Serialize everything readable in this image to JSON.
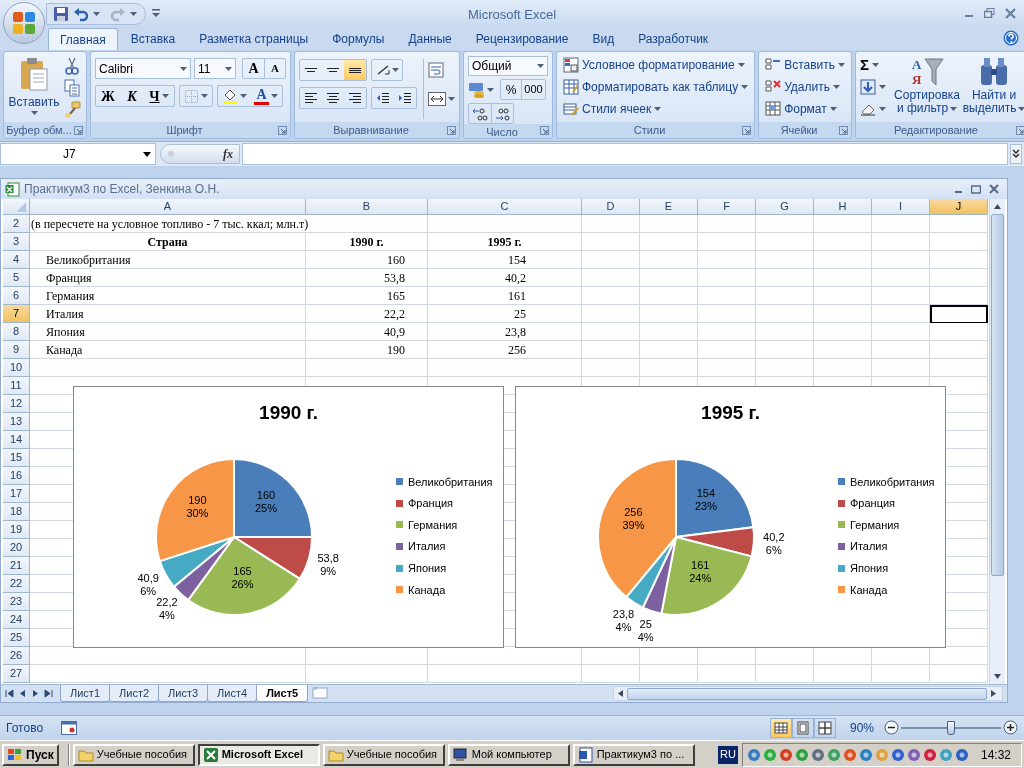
{
  "window": {
    "title": "Microsoft Excel"
  },
  "tabs": [
    {
      "label": "Главная",
      "selected": true
    },
    {
      "label": "Вставка",
      "selected": false
    },
    {
      "label": "Разметка страницы",
      "selected": false
    },
    {
      "label": "Формулы",
      "selected": false
    },
    {
      "label": "Данные",
      "selected": false
    },
    {
      "label": "Рецензирование",
      "selected": false
    },
    {
      "label": "Вид",
      "selected": false
    },
    {
      "label": "Разработчик",
      "selected": false
    }
  ],
  "ribbon": {
    "clipboard": {
      "label": "Буфер обм...",
      "paste": "Вставить"
    },
    "font": {
      "label": "Шрифт",
      "font_name": "Calibri",
      "font_size": "11",
      "grow_glyph": "A",
      "shrink_glyph": "A",
      "bold": "Ж",
      "italic": "К",
      "underline": "Ч",
      "font_color_glyph": "A"
    },
    "alignment": {
      "label": "Выравнивание",
      "vertical_align": [
        {
          "selected": false
        },
        {
          "selected": false
        },
        {
          "selected": true
        }
      ]
    },
    "number": {
      "label": "Число",
      "format": "Общий",
      "percent": "%",
      "thousands": "000"
    },
    "styles": {
      "label": "Стили",
      "items": [
        "Условное форматирование",
        "Форматировать как таблицу",
        "Стили ячеек"
      ]
    },
    "cells": {
      "label": "Ячейки",
      "items": [
        "Вставить",
        "Удалить",
        "Формат"
      ]
    },
    "editing": {
      "label": "Редактирование",
      "sum_glyph": "Σ",
      "sort_glyphs": [
        "А",
        "Я"
      ],
      "sort": [
        "Сортировка",
        "и фильтр"
      ],
      "find": [
        "Найти и",
        "выделить"
      ]
    }
  },
  "formula_bar": {
    "name_box": "J7",
    "function_glyph": "fx"
  },
  "workbook": {
    "title": "Практикум3 по Excel, Зенкина О.Н.",
    "columns": [
      {
        "label": "A",
        "selected": false
      },
      {
        "label": "B",
        "selected": false
      },
      {
        "label": "C",
        "selected": false
      },
      {
        "label": "D",
        "selected": false
      },
      {
        "label": "E",
        "selected": false
      },
      {
        "label": "F",
        "selected": false
      },
      {
        "label": "G",
        "selected": false
      },
      {
        "label": "H",
        "selected": false
      },
      {
        "label": "I",
        "selected": false
      },
      {
        "label": "J",
        "selected": true
      }
    ],
    "rows": [
      {
        "number": "2",
        "selected": false,
        "kind": "note",
        "cells": [
          "(в пересчете на условное топливо  - 7 тыс. ккал; млн.т)"
        ]
      },
      {
        "number": "3",
        "selected": false,
        "kind": "header",
        "cells": [
          "Страна",
          "1990 г.",
          "1995 г."
        ]
      },
      {
        "number": "4",
        "selected": false,
        "kind": "data",
        "cells": [
          "Великобритания",
          "160",
          "154"
        ]
      },
      {
        "number": "5",
        "selected": false,
        "kind": "data",
        "cells": [
          "Франция",
          "53,8",
          "40,2"
        ]
      },
      {
        "number": "6",
        "selected": false,
        "kind": "data",
        "cells": [
          "Германия",
          "165",
          "161"
        ]
      },
      {
        "number": "7",
        "selected": true,
        "kind": "data",
        "cells": [
          "Италия",
          "22,2",
          "25"
        ]
      },
      {
        "number": "8",
        "selected": false,
        "kind": "data",
        "cells": [
          "Япония",
          "40,9",
          "23,8"
        ]
      },
      {
        "number": "9",
        "selected": false,
        "kind": "data",
        "cells": [
          "Канада",
          "190",
          "256"
        ]
      },
      {
        "number": "10",
        "selected": false
      },
      {
        "number": "11",
        "selected": false
      },
      {
        "number": "12",
        "selected": false
      },
      {
        "number": "13",
        "selected": false
      },
      {
        "number": "14",
        "selected": false
      },
      {
        "number": "15",
        "selected": false
      },
      {
        "number": "16",
        "selected": false
      },
      {
        "number": "17",
        "selected": false
      },
      {
        "number": "18",
        "selected": false
      },
      {
        "number": "19",
        "selected": false
      },
      {
        "number": "20",
        "selected": false
      },
      {
        "number": "21",
        "selected": false
      },
      {
        "number": "22",
        "selected": false
      },
      {
        "number": "23",
        "selected": false
      },
      {
        "number": "24",
        "selected": false
      },
      {
        "number": "25",
        "selected": false
      },
      {
        "number": "26",
        "selected": false
      },
      {
        "number": "27",
        "selected": false
      }
    ],
    "charts": [
      {
        "chart_data": {
          "type": "pie",
          "title": "1990 г.",
          "categories": [
            "Великобритания",
            "Франция",
            "Германия",
            "Италия",
            "Япония",
            "Канада"
          ],
          "series": [
            {
              "values": [
                25,
                9,
                26,
                4,
                6,
                30
              ]
            }
          ],
          "legend": true,
          "colors": [
            "#4a7ebb",
            "#be4b48",
            "#98b954",
            "#7d60a0",
            "#46aac5",
            "#f79646"
          ],
          "value_labels": [
            "160\n25%",
            "53,8\n9%",
            "165\n26%",
            "22,2\n4%",
            "40,9\n6%",
            "190\n30%"
          ]
        }
      },
      {
        "chart_data": {
          "type": "pie",
          "title": "1995 г.",
          "categories": [
            "Великобритания",
            "Франция",
            "Германия",
            "Италия",
            "Япония",
            "Канада"
          ],
          "series": [
            {
              "values": [
                23,
                6,
                24,
                4,
                4,
                39
              ]
            }
          ],
          "legend": true,
          "colors": [
            "#4a7ebb",
            "#be4b48",
            "#98b954",
            "#7d60a0",
            "#46aac5",
            "#f79646"
          ],
          "value_labels": [
            "154\n23%",
            "40,2\n6%",
            "161\n24%",
            "25\n4%",
            "23,8\n4%",
            "256\n39%"
          ]
        }
      }
    ],
    "sheet_tabs": [
      {
        "label": "Лист1",
        "selected": false
      },
      {
        "label": "Лист2",
        "selected": false
      },
      {
        "label": "Лист3",
        "selected": false
      },
      {
        "label": "Лист4",
        "selected": false
      },
      {
        "label": "Лист5",
        "selected": true
      }
    ]
  },
  "status_bar": {
    "text": "Готово",
    "views": [
      {
        "selected": true
      },
      {
        "selected": false
      },
      {
        "selected": false
      }
    ],
    "zoom": "90%",
    "zoom_slider": {
      "level": 0.5
    }
  },
  "taskbar": {
    "start": "Пуск",
    "items": [
      {
        "label": "Учебные пособия",
        "kind": "folder",
        "selected": false
      },
      {
        "label": "Microsoft Excel",
        "kind": "excel",
        "selected": true
      },
      {
        "label": "Учебные пособия",
        "kind": "folder",
        "selected": false
      },
      {
        "label": "Мой компьютер",
        "kind": "computer",
        "selected": false
      },
      {
        "label": "Практикум3 по ...",
        "kind": "word",
        "selected": false
      }
    ],
    "language": "RU",
    "clock": "14:32"
  }
}
